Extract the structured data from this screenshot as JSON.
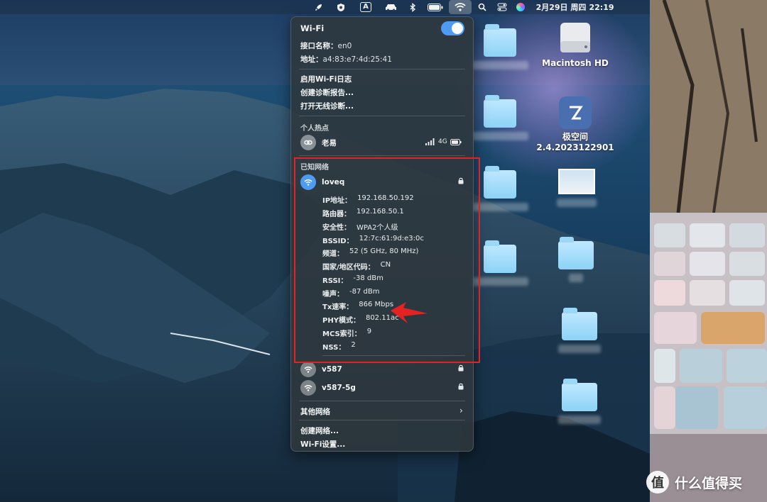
{
  "menubar": {
    "date": "2月29日 周四",
    "time": "22:19"
  },
  "desktop": {
    "drive_label": "Macintosh HD",
    "app_label_line1": "极空间",
    "app_label_line2": "2.4.2023122901"
  },
  "wifi": {
    "title": "Wi-Fi",
    "toggle_on": true,
    "interface_label": "接口名称：",
    "interface_value": "en0",
    "address_label": "地址：",
    "address_value": "a4:83:e7:4d:25:41",
    "actions": [
      "启用Wi-Fi日志",
      "创建诊断报告...",
      "打开无线诊断..."
    ],
    "hotspot_header": "个人热点",
    "hotspot_name": "老易",
    "hotspot_signal": "4G",
    "known_header": "已知网络",
    "current_network": "loveq",
    "details": [
      {
        "k": "IP地址：",
        "v": "192.168.50.192"
      },
      {
        "k": "路由器：",
        "v": "192.168.50.1"
      },
      {
        "k": "安全性：",
        "v": "WPA2个人级"
      },
      {
        "k": "BSSID：",
        "v": "12:7c:61:9d:e3:0c"
      },
      {
        "k": "频道：",
        "v": "52 (5 GHz, 80 MHz)"
      },
      {
        "k": "国家/地区代码：",
        "v": "CN"
      },
      {
        "k": "RSSI：",
        "v": "-38 dBm"
      },
      {
        "k": "噪声：",
        "v": "-87 dBm"
      },
      {
        "k": "Tx速率：",
        "v": "866 Mbps"
      },
      {
        "k": "PHY模式：",
        "v": "802.11ac"
      },
      {
        "k": "MCS索引：",
        "v": "9"
      },
      {
        "k": "NSS：",
        "v": "2"
      }
    ],
    "other_known": [
      "v587",
      "v587-5g"
    ],
    "other_networks": "其他网络",
    "footer": [
      "创建网络...",
      "Wi-Fi设置..."
    ]
  },
  "watermark": {
    "logo": "值",
    "text": "什么值得买"
  },
  "colors": {
    "accent": "#4d9cf2",
    "annotation": "#e52222",
    "folder": "#8dd3f7"
  }
}
